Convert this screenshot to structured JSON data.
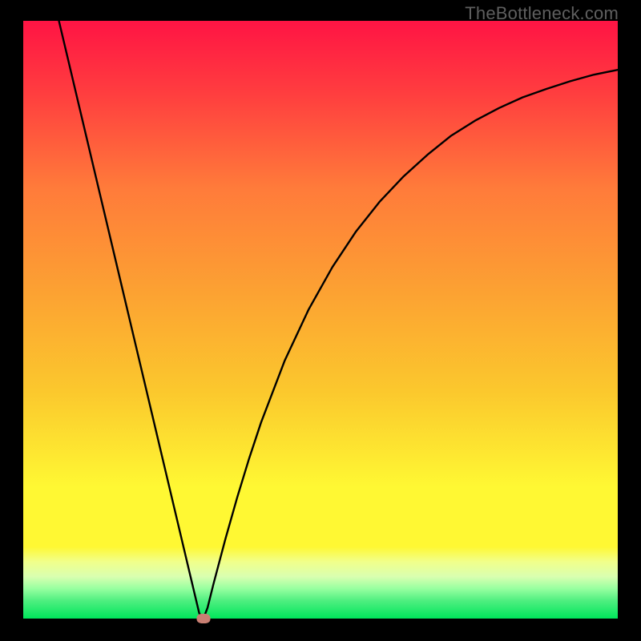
{
  "watermark": "TheBottleneck.com",
  "chart_data": {
    "type": "line",
    "title": "",
    "xlabel": "",
    "ylabel": "",
    "xlim": [
      0,
      100
    ],
    "ylim": [
      0,
      100
    ],
    "grid": false,
    "gradient_colors": {
      "top": "#ff1444",
      "upper": "#ff7b3a",
      "mid": "#fbc82d",
      "lower_mid": "#fff833",
      "band_light": "#f1ff8b",
      "band_green_light": "#97ffa0",
      "bottom": "#00e65b"
    },
    "series": [
      {
        "name": "bottleneck-curve",
        "color": "#000000",
        "x": [
          6.0,
          8.0,
          10.0,
          12.0,
          14.0,
          16.0,
          18.0,
          20.0,
          22.0,
          24.0,
          26.0,
          28.0,
          29.6,
          30.3,
          31.0,
          32.0,
          34.0,
          36.0,
          38.0,
          40.0,
          44.0,
          48.0,
          52.0,
          56.0,
          60.0,
          64.0,
          68.0,
          72.0,
          76.0,
          80.0,
          84.0,
          88.0,
          92.0,
          96.0,
          100.0
        ],
        "y": [
          100.0,
          91.6,
          83.2,
          74.8,
          66.4,
          58.0,
          49.6,
          41.2,
          32.8,
          24.4,
          16.0,
          7.6,
          0.9,
          0.0,
          1.8,
          5.8,
          13.3,
          20.3,
          26.8,
          32.8,
          43.2,
          51.7,
          58.8,
          64.8,
          69.8,
          74.0,
          77.6,
          80.8,
          83.3,
          85.4,
          87.2,
          88.6,
          89.9,
          91.0,
          91.8
        ]
      }
    ],
    "marker": {
      "x": 30.3,
      "y": 0.0,
      "color": "#c97f73"
    }
  }
}
